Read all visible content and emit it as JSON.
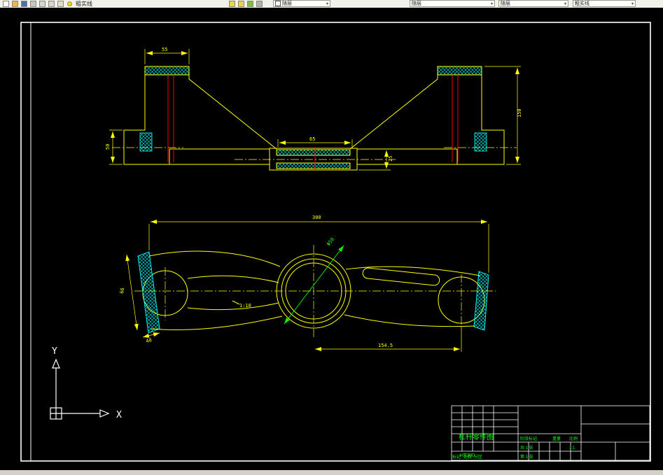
{
  "toolbar": {
    "layer_label": "粗实线",
    "color_combo": "随层",
    "linetype_combo": "随层",
    "lineweight_combo": "随层",
    "style_combo": "粗实线",
    "icons": [
      "new-file",
      "open-file",
      "save",
      "print",
      "cut",
      "copy",
      "paste",
      "zoom-window",
      "zoom-pan",
      "osnap",
      "ortho",
      "layer-bulb"
    ]
  },
  "colors": {
    "background": "#000000",
    "outline": "#ffff00",
    "hatch": "#00ffff",
    "section_line": "#ff0000",
    "accent": "#00ff00",
    "frame": "#ffffff",
    "toolbar_bg": "#f2f1ea"
  },
  "front_view": {
    "dims": {
      "cap_width": "55",
      "boss_width": "65",
      "overall_height": "150",
      "flange_height": "50",
      "boss_height": "25"
    }
  },
  "plan_view": {
    "dims": {
      "overall_length": "300",
      "bore": "Φ50",
      "taper": "1:10",
      "center_to_end": "154.5",
      "end_width": "66",
      "cap_width": "40"
    }
  },
  "ucs": {
    "x_label": "X",
    "y_label": "Y"
  },
  "title_block": {
    "title": "杠杆零件图",
    "material": "HT200",
    "stage_label": "阶段标记",
    "weight_label": "重量",
    "scale_label": "比例",
    "scale_value": "1:1",
    "sheet_total": "共 1 张",
    "sheet_no": "第 1 张",
    "mark_label": "标记",
    "count_label": "处数",
    "zone_label": "分区"
  }
}
